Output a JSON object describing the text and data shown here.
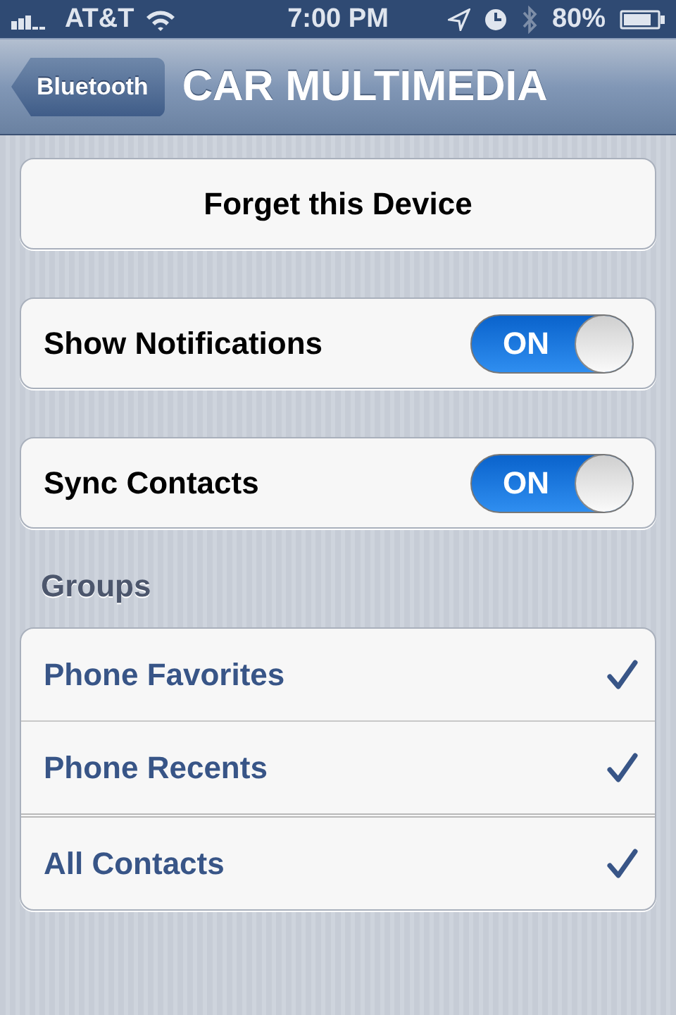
{
  "status_bar": {
    "carrier": "AT&T",
    "time": "7:00 PM",
    "battery": "80%"
  },
  "nav_bar": {
    "back_button": "Bluetooth",
    "title": "CAR MULTIMEDIA"
  },
  "sections": [
    {
      "kind": "button",
      "label": "Forget this Device"
    },
    {
      "kind": "toggle",
      "label": "Show Notifications",
      "on": true,
      "state_text": "ON"
    },
    {
      "kind": "toggle",
      "label": "Sync Contacts",
      "on": true,
      "state_text": "ON"
    },
    {
      "kind": "list",
      "header": "Groups",
      "items": [
        {
          "label": "Phone Favorites",
          "checked": true
        },
        {
          "label": "Phone Recents",
          "checked": true
        },
        {
          "label": "All Contacts",
          "checked": true
        }
      ]
    }
  ]
}
